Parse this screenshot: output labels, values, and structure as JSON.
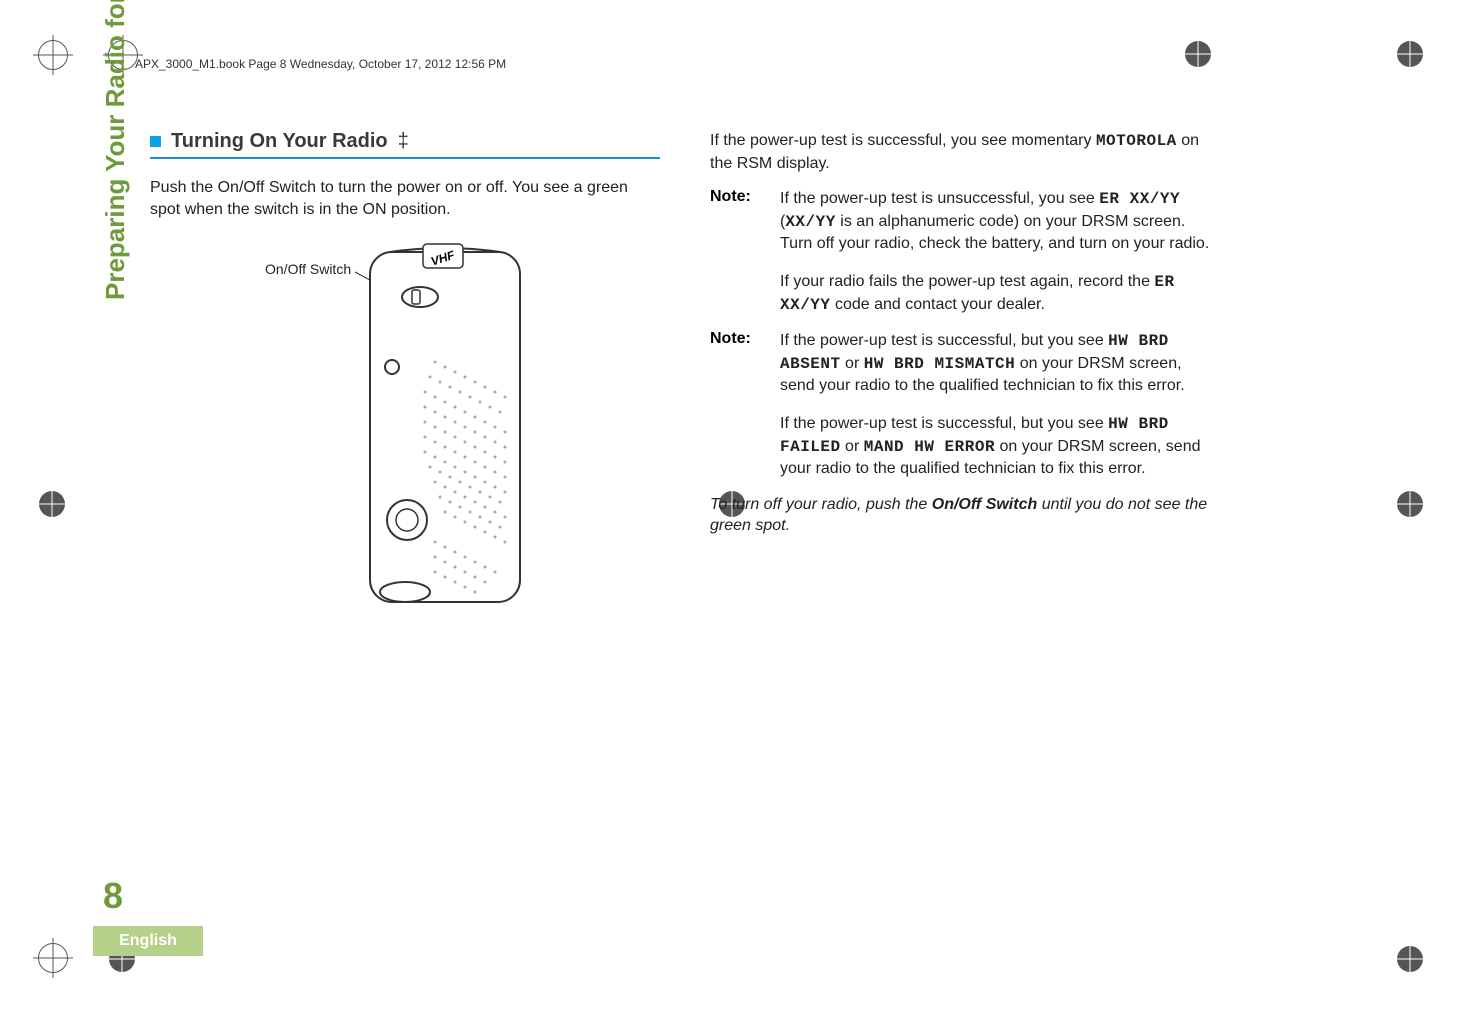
{
  "meta": {
    "book_header": "APX_3000_M1.book  Page 8  Wednesday, October 17, 2012  12:56 PM"
  },
  "side": {
    "section": "Preparing Your Radio for Use",
    "page_number": "8",
    "language": "English"
  },
  "left": {
    "heading": "Turning On Your Radio",
    "dagger": "‡",
    "intro": "Push the On/Off Switch to turn the power on or off. You see a green spot when the switch is in the ON position.",
    "switch_label": "On/Off Switch"
  },
  "right": {
    "success_prefix": "If the power-up test is successful, you see momentary ",
    "success_code": "MOTOROLA",
    "success_suffix": " on the RSM display.",
    "note1": {
      "label": "Note:",
      "p1_a": "If the power-up test is unsuccessful, you see ",
      "p1_code1": "ER XX/YY",
      "p1_b": " (",
      "p1_code2": "XX/YY",
      "p1_c": " is an alphanumeric code) on your DRSM screen. Turn off your radio, check the battery, and turn on your radio.",
      "p2_a": "If your radio fails the power-up test again, record the ",
      "p2_code": "ER XX/YY",
      "p2_b": " code and contact your dealer."
    },
    "note2": {
      "label": "Note:",
      "p1_a": "If the power-up test is successful, but you see ",
      "p1_code1": "HW BRD ABSENT",
      "p1_b": " or ",
      "p1_code2": "HW BRD MISMATCH",
      "p1_c": " on your DRSM screen, send your radio to the qualified technician to fix this error.",
      "p2_a": "If the power-up test is successful, but you see ",
      "p2_code1": "HW BRD FAILED",
      "p2_b": " or ",
      "p2_code2": "MAND HW ERROR",
      "p2_c": " on your DRSM screen, send your radio to the qualified technician to fix this error."
    },
    "turnoff_a": "To turn off your radio, push the ",
    "turnoff_bold": "On/Off Switch",
    "turnoff_b": " until you do not see the green spot."
  }
}
